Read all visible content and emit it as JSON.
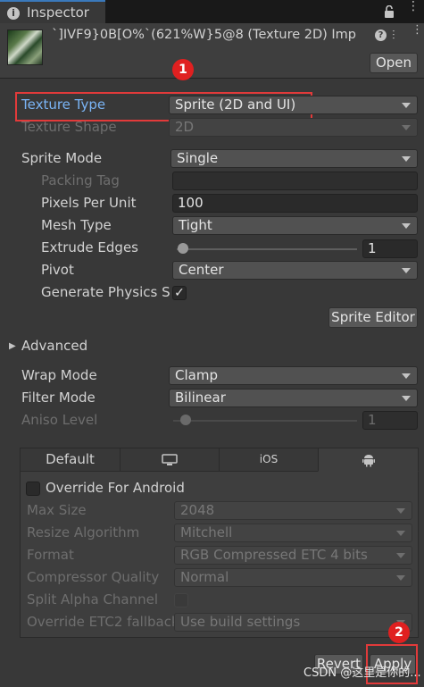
{
  "window": {
    "tab_label": "Inspector",
    "icons": [
      "info-icon",
      "lock-icon",
      "more-menu-icon"
    ]
  },
  "header": {
    "title": "`]IVF9}0B[O%`(621%W}5@8 (Texture 2D) Imp",
    "open_label": "Open",
    "icons": [
      "help-icon",
      "presets-icon",
      "menu-icon"
    ]
  },
  "fields": {
    "texture_type": {
      "label": "Texture Type",
      "value": "Sprite (2D and UI)"
    },
    "texture_shape": {
      "label": "Texture Shape",
      "value": "2D"
    },
    "sprite_mode": {
      "label": "Sprite Mode",
      "value": "Single"
    },
    "packing_tag": {
      "label": "Packing Tag",
      "value": ""
    },
    "pixels_per_unit": {
      "label": "Pixels Per Unit",
      "value": "100"
    },
    "mesh_type": {
      "label": "Mesh Type",
      "value": "Tight"
    },
    "extrude_edges": {
      "label": "Extrude Edges",
      "value": "1",
      "slider_fraction": 0.06
    },
    "pivot": {
      "label": "Pivot",
      "value": "Center"
    },
    "generate_physics": {
      "label": "Generate Physics Sl",
      "checked": true
    },
    "sprite_editor_label": "Sprite Editor",
    "advanced_label": "Advanced",
    "wrap_mode": {
      "label": "Wrap Mode",
      "value": "Clamp"
    },
    "filter_mode": {
      "label": "Filter Mode",
      "value": "Bilinear"
    },
    "aniso_level": {
      "label": "Aniso Level",
      "value": "1",
      "slider_fraction": 0.06
    }
  },
  "platform": {
    "tabs": [
      {
        "label": "Default",
        "icon": null
      },
      {
        "label": "",
        "icon": "monitor-icon"
      },
      {
        "label": "iOS",
        "icon": null
      },
      {
        "label": "",
        "icon": "android-icon"
      }
    ],
    "active_tab": 3,
    "override_label": "Override For Android",
    "override_checked": false,
    "max_size": {
      "label": "Max Size",
      "value": "2048"
    },
    "resize_algorithm": {
      "label": "Resize Algorithm",
      "value": "Mitchell"
    },
    "format": {
      "label": "Format",
      "value": "RGB Compressed ETC 4 bits"
    },
    "compressor_quality": {
      "label": "Compressor Quality",
      "value": "Normal"
    },
    "split_alpha": {
      "label": "Split Alpha Channel"
    },
    "override_etc2": {
      "label": "Override ETC2 fallback",
      "value": "Use build settings"
    }
  },
  "footer": {
    "revert_label": "Revert",
    "apply_label": "Apply"
  },
  "annotations": {
    "badge1": "1",
    "badge2": "2",
    "highlight_color": "#e23a3a"
  },
  "watermark": "CSDN @这里是你的..."
}
